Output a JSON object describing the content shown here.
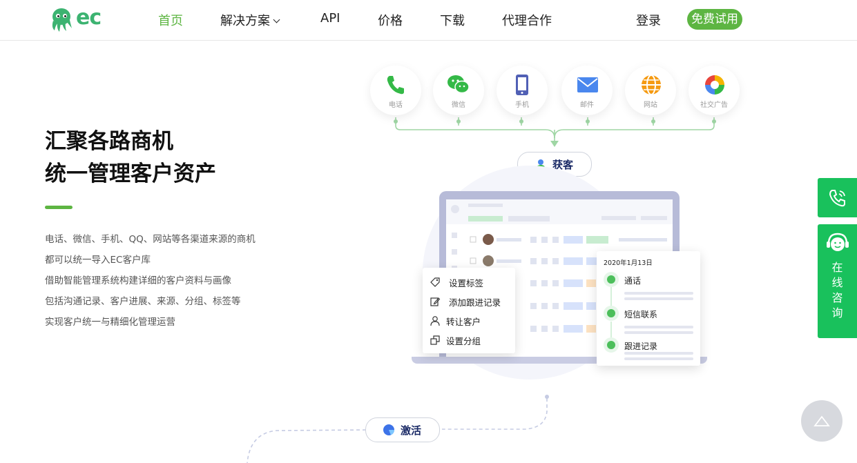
{
  "header": {
    "logo_text": "ec",
    "nav": [
      {
        "label": "首页"
      },
      {
        "label": "解决方案"
      },
      {
        "label": "API"
      },
      {
        "label": "价格"
      },
      {
        "label": "下载"
      },
      {
        "label": "代理合作"
      }
    ],
    "login_label": "登录",
    "trial_label": "免费试用"
  },
  "hero": {
    "title_line1": "汇聚各路商机",
    "title_line2": "统一管理客户资产",
    "desc": [
      "电话、微信、手机、QQ、网站等各渠道来源的商机",
      "都可以统一导入EC客户库",
      "借助智能管理系统构建详细的客户资料与画像",
      "包括沟通记录、客户进展、来源、分组、标签等",
      "实现客户统一与精细化管理运营"
    ]
  },
  "channels": [
    {
      "label": "电话",
      "icon": "phone-icon"
    },
    {
      "label": "微信",
      "icon": "wechat-icon"
    },
    {
      "label": "手机",
      "icon": "mobile-icon"
    },
    {
      "label": "邮件",
      "icon": "mail-icon"
    },
    {
      "label": "网站",
      "icon": "globe-icon"
    },
    {
      "label": "社交广告",
      "icon": "social-ads-icon"
    }
  ],
  "acquire_label": "获客",
  "activate_label": "激活",
  "context_menu": [
    {
      "label": "设置标签",
      "icon": "tag-icon"
    },
    {
      "label": "添加跟进记录",
      "icon": "edit-icon"
    },
    {
      "label": "转让客户",
      "icon": "user-icon"
    },
    {
      "label": "设置分组",
      "icon": "group-icon"
    }
  ],
  "timeline": {
    "date": "2020年1月13日",
    "items": [
      {
        "label": "通话",
        "icon": "phone-icon"
      },
      {
        "label": "短信联系",
        "icon": "sms-icon"
      },
      {
        "label": "跟进记录",
        "icon": "pen-icon"
      }
    ]
  },
  "side": {
    "chat_label": "在线咨询",
    "chat_chars": [
      "在",
      "线",
      "咨",
      "询"
    ]
  },
  "colors": {
    "brand_green": "#5db542",
    "side_green": "#19c15c",
    "pill_text": "#1a2a66"
  }
}
